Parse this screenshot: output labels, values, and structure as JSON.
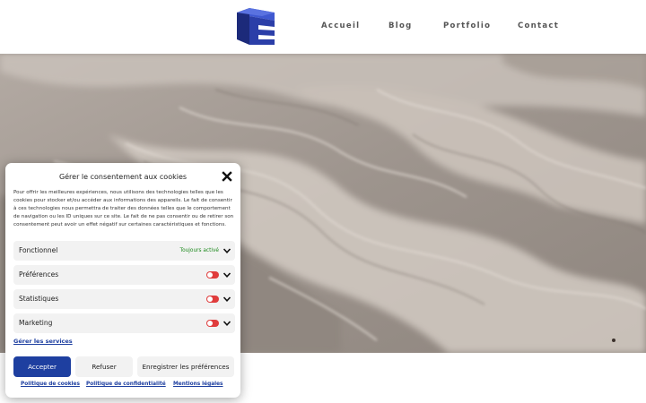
{
  "nav": {
    "items": [
      "Accueil",
      "Blog",
      "Portfolio",
      "Contact"
    ]
  },
  "logo": {
    "icon": "stacked-e-logo-icon",
    "colors": [
      "#2b3ea8",
      "#3f58d0",
      "#1c2a7a"
    ]
  },
  "hero": {
    "image": "marble-texture-background",
    "base_color": "#a09790"
  },
  "cookie_banner": {
    "title": "Gérer le consentement aux cookies",
    "close_icon": "close-icon",
    "description": "Pour offrir les meilleures expériences, nous utilisons des technologies telles que les cookies pour stocker et/ou accéder aux informations des appareils. Le fait de consentir à ces technologies nous permettra de traiter des données telles que le comportement de navigation ou les ID uniques sur ce site. Le fait de ne pas consentir ou de retirer son consentement peut avoir un effet négatif sur certaines caractéristiques et fonctions.",
    "categories": [
      {
        "label": "Fonctionnel",
        "status": "Toujours activé",
        "enabled": true
      },
      {
        "label": "Préférences",
        "enabled": false
      },
      {
        "label": "Statistiques",
        "enabled": false
      },
      {
        "label": "Marketing",
        "enabled": false
      }
    ],
    "manage_services": "Gérer les services",
    "buttons": {
      "accept": "Accepter",
      "refuse": "Refuser",
      "save_prefs": "Enregistrer les préférences"
    },
    "links": [
      "Politique de cookies",
      "Politique de confidentialité",
      "Mentions légales"
    ],
    "colors": {
      "accent": "#1e3fa0",
      "toggle_off": "#e03c3c",
      "always_on": "#1e8a1e",
      "row_bg": "#f2f2f2"
    }
  }
}
